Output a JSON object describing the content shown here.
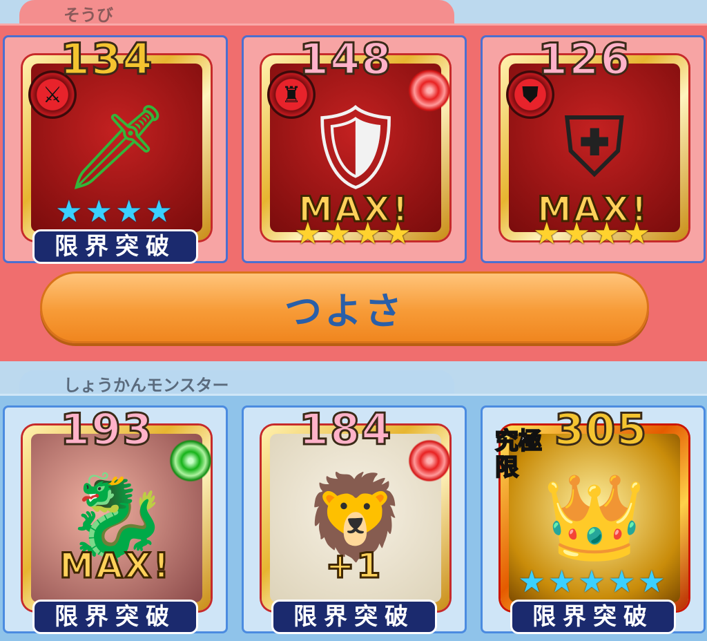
{
  "equipment": {
    "section_title": "そうび",
    "items": [
      {
        "level": "134",
        "type_icon": "sword-icon",
        "stars": "★★★★",
        "badge": "",
        "footer": "限界突破",
        "image": "green-sword"
      },
      {
        "level": "148",
        "type_icon": "armor-icon",
        "stars": "★★★★",
        "badge": "MAX!",
        "footer": "",
        "image": "white-armor"
      },
      {
        "level": "126",
        "type_icon": "shield-icon",
        "stars": "★★★★",
        "badge": "MAX!",
        "footer": "",
        "image": "black-shield"
      }
    ],
    "strength_button": "つよさ"
  },
  "summons": {
    "section_title": "しょうかんモンスター",
    "items": [
      {
        "level": "193",
        "badge": "MAX!",
        "footer": "限界突破",
        "image": "dragon-monster",
        "orb": "green"
      },
      {
        "level": "184",
        "badge": "+1",
        "footer": "限界突破",
        "image": "lion-monster",
        "orb": "red"
      },
      {
        "level": "305",
        "stars": "★★★★★",
        "footer": "限界突破",
        "rank_label": "究極限",
        "image": "golden-monster"
      }
    ]
  },
  "colors": {
    "equip_bg": "#f06e6e",
    "summon_bg": "#8fc3ea",
    "button": "#f79b37"
  }
}
